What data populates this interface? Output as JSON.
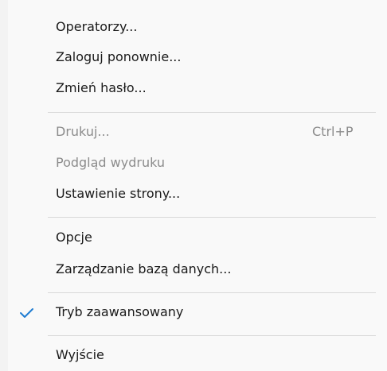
{
  "menu": {
    "items": [
      {
        "label": "Operatorzy...",
        "shortcut": "",
        "enabled": true,
        "checked": false
      },
      {
        "label": "Zaloguj ponownie...",
        "shortcut": "",
        "enabled": true,
        "checked": false
      },
      {
        "label": "Zmień hasło...",
        "shortcut": "",
        "enabled": true,
        "checked": false
      },
      {
        "label": "Drukuj...",
        "shortcut": "Ctrl+P",
        "enabled": false,
        "checked": false
      },
      {
        "label": "Podgląd wydruku",
        "shortcut": "",
        "enabled": false,
        "checked": false
      },
      {
        "label": "Ustawienie strony...",
        "shortcut": "",
        "enabled": true,
        "checked": false
      },
      {
        "label": "Opcje",
        "shortcut": "",
        "enabled": true,
        "checked": false
      },
      {
        "label": "Zarządzanie bazą danych...",
        "shortcut": "",
        "enabled": true,
        "checked": false
      },
      {
        "label": "Tryb zaawansowany",
        "shortcut": "",
        "enabled": true,
        "checked": true
      },
      {
        "label": "Wyjście",
        "shortcut": "",
        "enabled": true,
        "checked": false
      }
    ],
    "check_icon": "checkmark-icon",
    "colors": {
      "background": "#f9f9f9",
      "text": "#1a1a1a",
      "disabled_text": "#8c8c8c",
      "separator": "#d9d9d9",
      "check": "#1f7cd1"
    }
  }
}
